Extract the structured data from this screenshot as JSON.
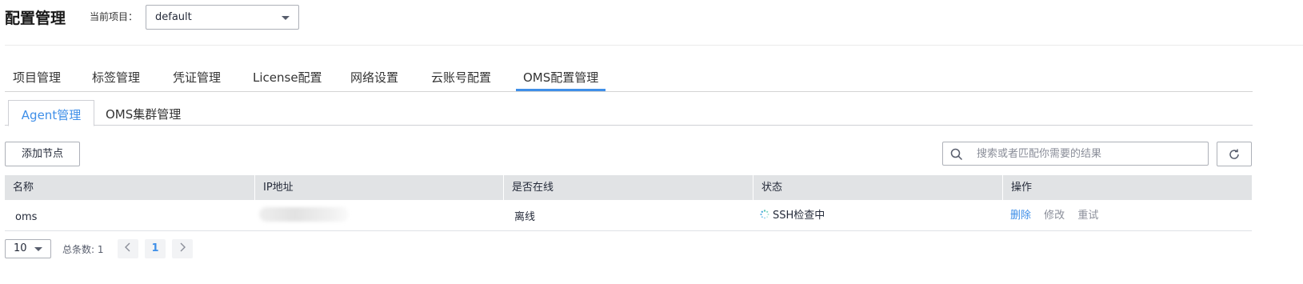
{
  "header": {
    "title": "配置管理",
    "project_label": "当前项目：",
    "project_value": "default"
  },
  "main_tabs": [
    {
      "label": "项目管理"
    },
    {
      "label": "标签管理"
    },
    {
      "label": "凭证管理"
    },
    {
      "label": "License配置"
    },
    {
      "label": "网络设置"
    },
    {
      "label": "云账号配置"
    },
    {
      "label": "OMS配置管理",
      "active": true
    }
  ],
  "sub_tabs": [
    {
      "label": "Agent管理",
      "active": true
    },
    {
      "label": "OMS集群管理"
    }
  ],
  "toolbar": {
    "add_label": "添加节点",
    "search_placeholder": "搜索或者匹配你需要的结果",
    "search_icon": "search-icon",
    "refresh_icon": "refresh-icon"
  },
  "table": {
    "columns": [
      "名称",
      "IP地址",
      "是否在线",
      "状态",
      "操作"
    ],
    "rows": [
      {
        "name": "oms",
        "ip": "",
        "online": "离线",
        "status": "SSH检查中",
        "actions": [
          "删除",
          "修改",
          "重试"
        ]
      }
    ]
  },
  "pagination": {
    "page_size": "10",
    "total": "总条数: 1",
    "current_page": "1"
  },
  "colors": {
    "accent": "#3f8fe8",
    "header_bg": "#e1e3e5",
    "spinner": "#5ac8b3"
  }
}
